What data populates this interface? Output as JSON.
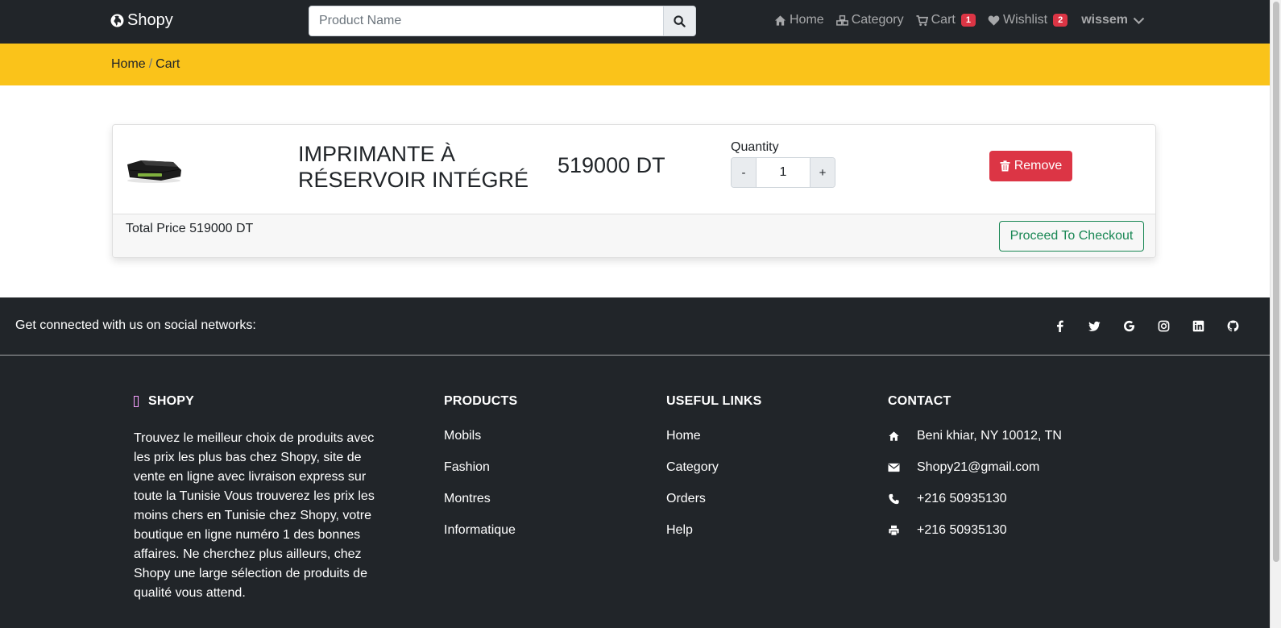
{
  "navbar": {
    "brand": "Shopy",
    "search_placeholder": "Product Name",
    "links": {
      "home": "Home",
      "category": "Category",
      "cart": "Cart",
      "cart_count": "1",
      "wishlist": "Wishlist",
      "wishlist_count": "2",
      "user": "wissem"
    }
  },
  "breadcrumb": {
    "home": "Home",
    "separator": "/",
    "current": "Cart"
  },
  "cart": {
    "item": {
      "name": "IMPRIMANTE À RÉSERVOIR INTÉGRÉ",
      "price": "519000 DT",
      "quantity_label": "Quantity",
      "quantity": "1",
      "minus": "-",
      "plus": "+",
      "remove_label": "Remove"
    },
    "total_text": "Total Price 519000 DT",
    "checkout_label": "Proceed To Checkout"
  },
  "footer": {
    "social_text": "Get connected with us on social networks:",
    "social_icons": [
      "facebook-icon",
      "twitter-icon",
      "google-icon",
      "instagram-icon",
      "linkedin-icon",
      "github-icon"
    ],
    "about": {
      "title": "SHOPY",
      "text": "Trouvez le meilleur choix de produits avec les prix les plus bas chez Shopy, site de vente en ligne avec livraison express sur toute la Tunisie Vous trouverez les prix les moins chers en Tunisie chez Shopy, votre boutique en ligne numéro 1 des bonnes affaires. Ne cherchez plus ailleurs, chez Shopy une large sélection de produits de qualité vous attend."
    },
    "products": {
      "title": "PRODUCTS",
      "items": [
        "Mobils",
        "Fashion",
        "Montres",
        "Informatique"
      ]
    },
    "useful_links": {
      "title": "USEFUL LINKS",
      "items": [
        "Home",
        "Category",
        "Orders",
        "Help"
      ]
    },
    "contact": {
      "title": "CONTACT",
      "address": "Beni khiar, NY 10012, TN",
      "email": "Shopy21@gmail.com",
      "phone": "+216 50935130",
      "fax": "+216 50935130"
    }
  },
  "colors": {
    "navbar_bg": "#212529",
    "breadcrumb_bg": "#fac31a",
    "danger": "#dc3545",
    "success": "#198754"
  }
}
